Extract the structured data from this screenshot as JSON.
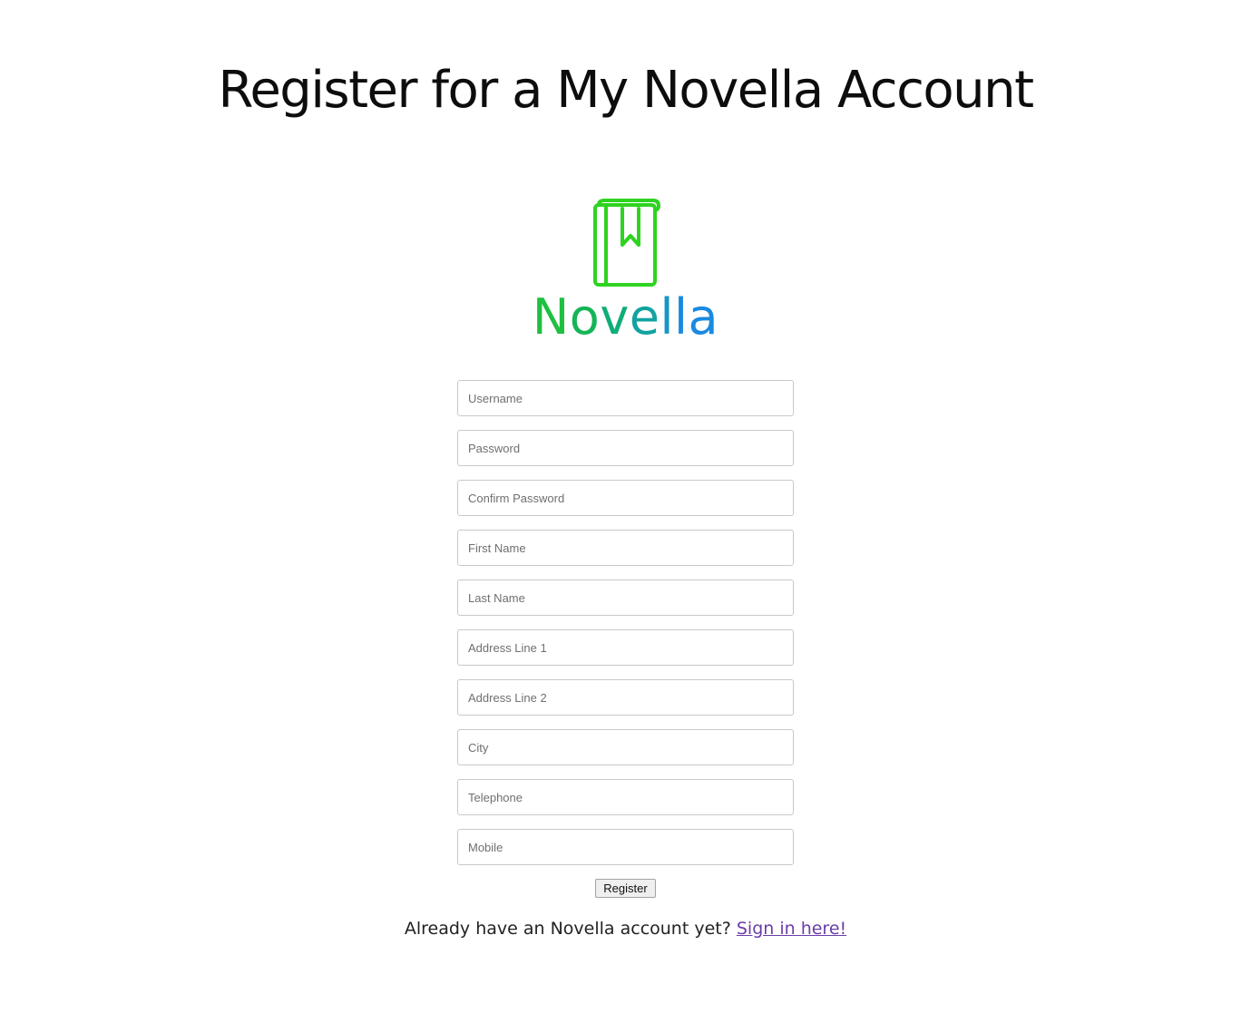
{
  "page": {
    "title": "Register for a My Novella Account"
  },
  "logo": {
    "icon": "book-bookmark-icon",
    "letters": [
      "N",
      "o",
      "v",
      "e",
      "l",
      "la"
    ],
    "colors": {
      "icon": "#2ed320",
      "text_start": "#1fbf3f",
      "text_end": "#198ae0"
    }
  },
  "form": {
    "fields": [
      {
        "placeholder": "Username",
        "value": ""
      },
      {
        "placeholder": "Password",
        "value": ""
      },
      {
        "placeholder": "Confirm Password",
        "value": ""
      },
      {
        "placeholder": "First Name",
        "value": ""
      },
      {
        "placeholder": "Last Name",
        "value": ""
      },
      {
        "placeholder": "Address Line 1",
        "value": ""
      },
      {
        "placeholder": "Address Line 2",
        "value": ""
      },
      {
        "placeholder": "City",
        "value": ""
      },
      {
        "placeholder": "Telephone",
        "value": ""
      },
      {
        "placeholder": "Mobile",
        "value": ""
      }
    ],
    "register_label": "Register"
  },
  "signin": {
    "prompt": "Already have an Novella account yet?",
    "link_label": "Sign in here!"
  }
}
